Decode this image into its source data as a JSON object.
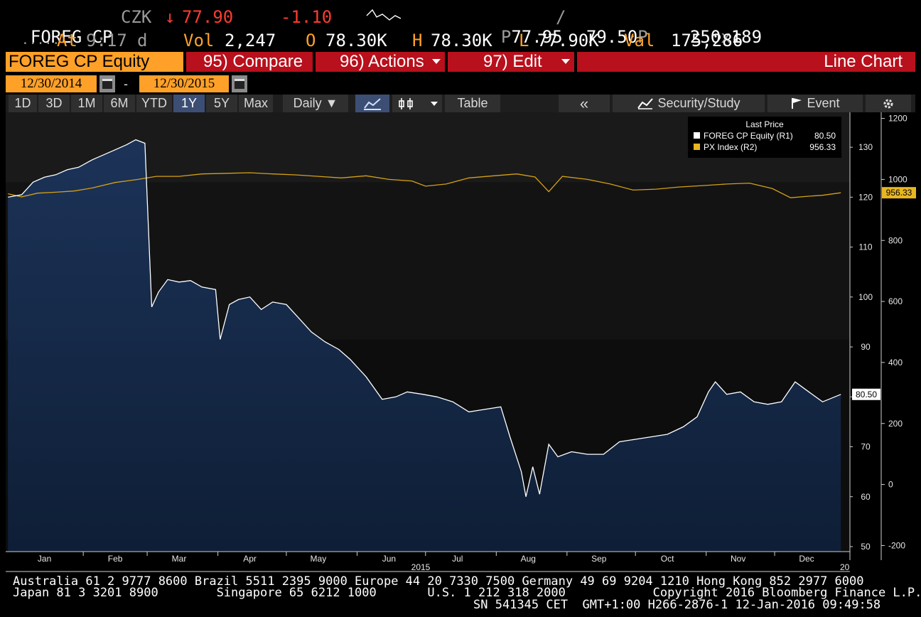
{
  "quote": {
    "ticker": "FOREG CP",
    "currency": "CZK",
    "arrow": "↓",
    "price": "77.90",
    "change": "-1.10",
    "bid_prefix": "P",
    "bid": "77.95",
    "slash": "/",
    "ask": "79.50",
    "ask_suffix": "P",
    "size_bid": "250",
    "size_x": "x",
    "size_ask": "189",
    "dots": ".....",
    "at_label": "At",
    "time": "9:17",
    "time_suffix": "d",
    "vol_label": "Vol",
    "vol": "2,247",
    "open_label": "O",
    "open": "78.30K",
    "high_label": "H",
    "high": "78.30K",
    "low_label": "L",
    "low": "77.90K",
    "val_label": "Val",
    "val": "175,286"
  },
  "toolbar": {
    "security": "FOREG CP Equity",
    "compare": "95) Compare",
    "actions": "96) Actions",
    "edit": "97) Edit",
    "chart_type": "Line Chart",
    "start_date": "12/30/2014",
    "dash": "-",
    "end_date": "12/30/2015",
    "ranges": [
      "1D",
      "3D",
      "1M",
      "6M",
      "YTD",
      "1Y",
      "5Y",
      "Max"
    ],
    "selected_range": "1Y",
    "frequency": "Daily ▼",
    "table": "Table",
    "back": "«",
    "security_study": "Security/Study",
    "event": "Event"
  },
  "colors": {
    "accent": "#ffa028",
    "bar_red": "#b8101c",
    "series_white": "#ffffff",
    "series_gold": "#d4a017",
    "area_fill": "#16294a"
  },
  "icons": [
    "calendar-icon",
    "line-chart-icon",
    "candle-icon",
    "chevron-left-icon",
    "study-icon",
    "flag-icon",
    "gear-icon"
  ],
  "chart_data": {
    "type": "line",
    "legend_title": "Last Price",
    "legend_position": "top-right",
    "series": [
      {
        "name": "FOREG CP Equity  (R1)",
        "last": "80.50",
        "axis": "left",
        "x": [
          "2014-12-30",
          "2015-01-05",
          "2015-01-10",
          "2015-01-15",
          "2015-01-20",
          "2015-01-25",
          "2015-01-30",
          "2015-02-05",
          "2015-02-10",
          "2015-02-15",
          "2015-02-20",
          "2015-02-24",
          "2015-02-28",
          "2015-03-03",
          "2015-03-06",
          "2015-03-10",
          "2015-03-15",
          "2015-03-20",
          "2015-03-25",
          "2015-03-31",
          "2015-04-02",
          "2015-04-06",
          "2015-04-10",
          "2015-04-15",
          "2015-04-20",
          "2015-04-25",
          "2015-05-01",
          "2015-05-06",
          "2015-05-12",
          "2015-05-18",
          "2015-05-24",
          "2015-05-29",
          "2015-06-05",
          "2015-06-12",
          "2015-06-18",
          "2015-06-23",
          "2015-06-30",
          "2015-07-06",
          "2015-07-13",
          "2015-07-20",
          "2015-07-27",
          "2015-08-03",
          "2015-08-07",
          "2015-08-12",
          "2015-08-14",
          "2015-08-17",
          "2015-08-20",
          "2015-08-24",
          "2015-08-28",
          "2015-09-03",
          "2015-09-10",
          "2015-09-17",
          "2015-09-24",
          "2015-10-01",
          "2015-10-08",
          "2015-10-15",
          "2015-10-22",
          "2015-10-28",
          "2015-11-02",
          "2015-11-05",
          "2015-11-10",
          "2015-11-16",
          "2015-11-22",
          "2015-11-28",
          "2015-12-04",
          "2015-12-10",
          "2015-12-16",
          "2015-12-22",
          "2015-12-30"
        ],
        "values": [
          120,
          120.5,
          123,
          124,
          124.5,
          125.5,
          126,
          127.5,
          128.5,
          129.5,
          130.5,
          131.5,
          130.8,
          98,
          101,
          103.5,
          103,
          103.3,
          102,
          101.5,
          91.5,
          98.5,
          99.5,
          100,
          97.5,
          99,
          98.5,
          96,
          93,
          91,
          89.5,
          87.5,
          84,
          79.5,
          80,
          81,
          80.5,
          80,
          79,
          77,
          77.5,
          78,
          72,
          65,
          60,
          66,
          60.5,
          70.5,
          68,
          69,
          68.5,
          68.5,
          71,
          71.5,
          72,
          72.5,
          74,
          76,
          81,
          83,
          80.5,
          81,
          79,
          78.5,
          79,
          83,
          81,
          79,
          80.5
        ]
      },
      {
        "name": "PX Index  (R2)",
        "last": "956.33",
        "axis": "right",
        "x": [
          "2014-12-30",
          "2015-01-05",
          "2015-01-12",
          "2015-01-20",
          "2015-01-28",
          "2015-02-05",
          "2015-02-15",
          "2015-02-25",
          "2015-03-05",
          "2015-03-15",
          "2015-03-25",
          "2015-04-05",
          "2015-04-15",
          "2015-04-25",
          "2015-05-05",
          "2015-05-15",
          "2015-05-25",
          "2015-06-05",
          "2015-06-15",
          "2015-06-25",
          "2015-07-01",
          "2015-07-10",
          "2015-07-20",
          "2015-07-31",
          "2015-08-10",
          "2015-08-18",
          "2015-08-24",
          "2015-08-30",
          "2015-09-10",
          "2015-09-20",
          "2015-09-30",
          "2015-10-10",
          "2015-10-20",
          "2015-10-31",
          "2015-11-10",
          "2015-11-20",
          "2015-11-30",
          "2015-12-08",
          "2015-12-16",
          "2015-12-22",
          "2015-12-30"
        ],
        "values": [
          953,
          943,
          955,
          958,
          962,
          972,
          990,
          1000,
          1010,
          1010,
          1018,
          1020,
          1022,
          1018,
          1015,
          1010,
          1005,
          1012,
          1000,
          995,
          978,
          985,
          1005,
          1012,
          1018,
          1008,
          960,
          1010,
          1000,
          985,
          965,
          968,
          975,
          980,
          985,
          988,
          970,
          940,
          945,
          948,
          956.33
        ]
      }
    ],
    "left_axis": {
      "ticks": [
        "130",
        "120",
        "110",
        "100",
        "90",
        "80",
        "70",
        "60",
        "50"
      ],
      "range": [
        49,
        137
      ]
    },
    "right_axis": {
      "ticks": [
        "1200",
        "1000",
        "800",
        "600",
        "400",
        "200",
        "0",
        "-200"
      ],
      "range": [
        -220,
        1220
      ]
    },
    "x_ticks": [
      "Jan",
      "Feb",
      "Mar",
      "Apr",
      "May",
      "Jun",
      "Jul",
      "Aug",
      "Sep",
      "Oct",
      "Nov",
      "Dec"
    ],
    "x_sub_label": "2015",
    "x_right_label": "20",
    "grid": false
  },
  "footer": {
    "line1": "Australia 61 2 9777 8600 Brazil 5511 2395 9000 Europe 44 20 7330 7500 Germany 49 69 9204 1210 Hong Kong 852 2977 6000",
    "line2": "Japan 81 3 3201 8900        Singapore 65 6212 1000       U.S. 1 212 318 2000            Copyright 2016 Bloomberg Finance L.P.",
    "line3": "SN 541345 CET  GMT+1:00 H266-2876-1 12-Jan-2016 09:49:58"
  }
}
